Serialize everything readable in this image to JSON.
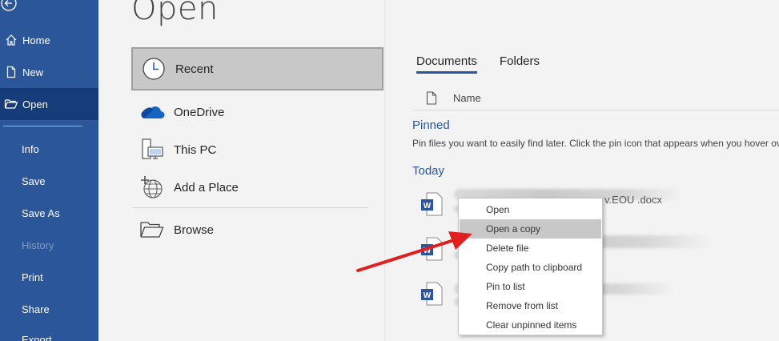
{
  "sidebar": {
    "items": [
      {
        "label": "Home"
      },
      {
        "label": "New"
      },
      {
        "label": "Open"
      },
      {
        "label": "Info"
      },
      {
        "label": "Save"
      },
      {
        "label": "Save As"
      },
      {
        "label": "History"
      },
      {
        "label": "Print"
      },
      {
        "label": "Share"
      },
      {
        "label": "Export"
      }
    ]
  },
  "page": {
    "title": "Open"
  },
  "locations": [
    {
      "label": "Recent"
    },
    {
      "label": "OneDrive"
    },
    {
      "label": "This PC"
    },
    {
      "label": "Add a Place"
    },
    {
      "label": "Browse"
    }
  ],
  "tabs": [
    {
      "label": "Documents"
    },
    {
      "label": "Folders"
    }
  ],
  "columns": {
    "name": "Name"
  },
  "pinned": {
    "title": "Pinned",
    "hint": "Pin files you want to easily find later. Click the pin icon that appears when you hover ov"
  },
  "today": {
    "title": "Today"
  },
  "files": [
    {
      "name_partial": "v.EOU .docx"
    }
  ],
  "context_menu": {
    "items": [
      {
        "label": "Open"
      },
      {
        "label": "Open a copy"
      },
      {
        "label": "Delete file"
      },
      {
        "label": "Copy path to clipboard"
      },
      {
        "label": "Pin to list"
      },
      {
        "label": "Remove from list"
      },
      {
        "label": "Clear unpinned items"
      }
    ]
  },
  "colors": {
    "sidebar": "#2b579a",
    "sidebar_active": "#163d7a",
    "accent": "#2b579a",
    "arrow": "#e02020"
  }
}
